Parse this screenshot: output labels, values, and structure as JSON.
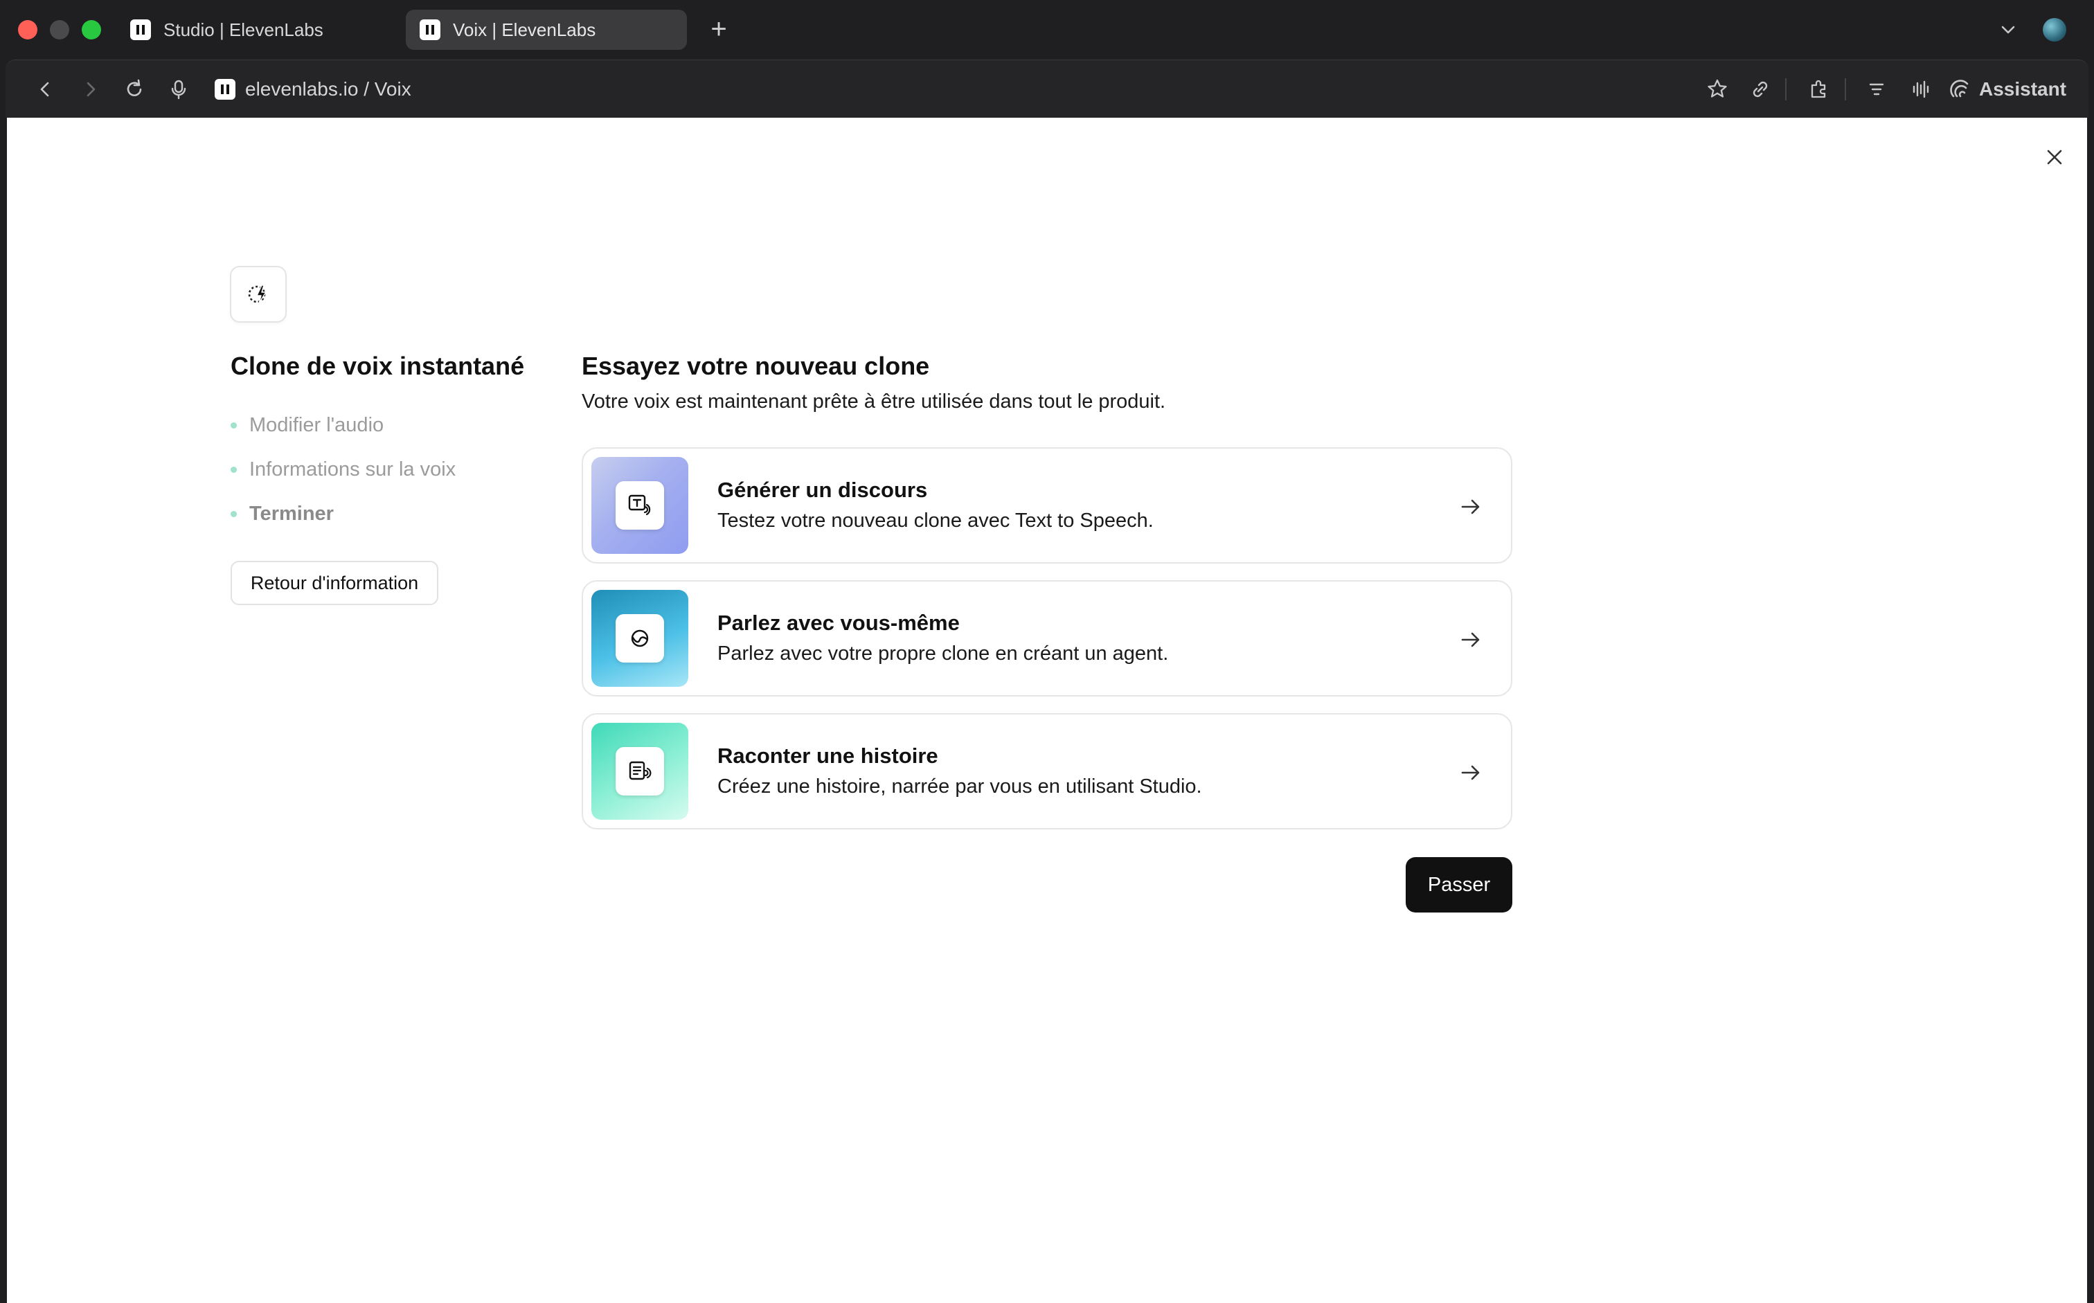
{
  "browser": {
    "tabs": [
      {
        "title": "Studio | ElevenLabs",
        "active": false
      },
      {
        "title": "Voix | ElevenLabs",
        "active": true
      }
    ],
    "new_tab_icon": "plus-icon",
    "url": "elevenlabs.io / Voix",
    "assistant_label": "Assistant"
  },
  "page": {
    "sidebar": {
      "title": "Clone de voix instantané",
      "steps": [
        {
          "label": "Modifier l'audio",
          "state": "done"
        },
        {
          "label": "Informations sur la voix",
          "state": "done"
        },
        {
          "label": "Terminer",
          "state": "current"
        }
      ],
      "back_button": "Retour d'information"
    },
    "main": {
      "title": "Essayez votre nouveau clone",
      "subtitle": "Votre voix est maintenant prête à être utilisée dans tout le produit.",
      "options": [
        {
          "title": "Générer un discours",
          "description": "Testez votre nouveau clone avec Text to Speech.",
          "icon": "text-to-speech-icon"
        },
        {
          "title": "Parlez avec vous-même",
          "description": "Parlez avec votre propre clone en créant un agent.",
          "icon": "agent-icon"
        },
        {
          "title": "Raconter une histoire",
          "description": "Créez une histoire, narrée par vous en utilisant Studio.",
          "icon": "studio-icon"
        }
      ],
      "skip_button": "Passer"
    }
  },
  "colors": {
    "accent_dark": "#111111",
    "step_dot": "#9fe3cf",
    "browser_chrome": "#1f1f21"
  }
}
